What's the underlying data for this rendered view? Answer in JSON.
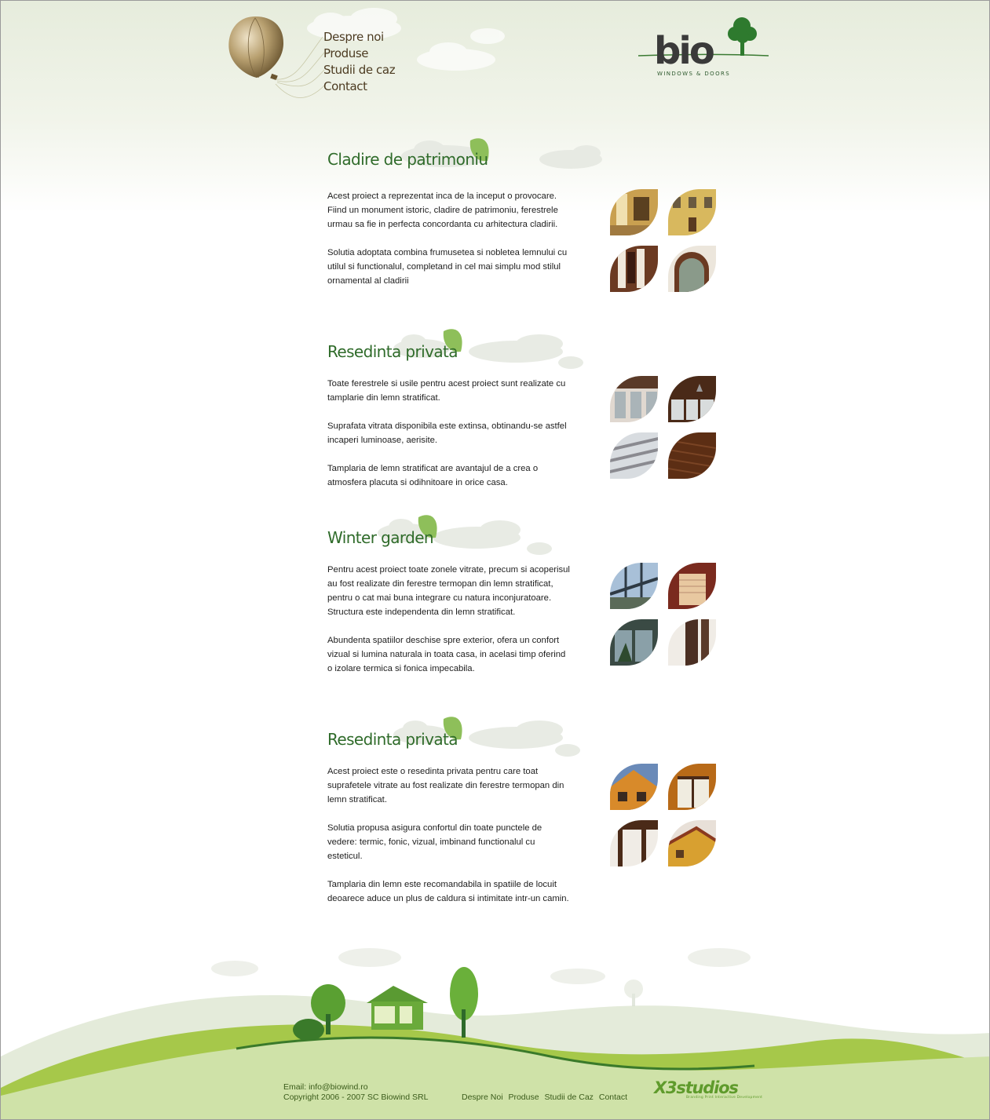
{
  "nav": {
    "items": [
      {
        "label": "Despre noi"
      },
      {
        "label": "Produse"
      },
      {
        "label": "Studii de caz"
      },
      {
        "label": "Contact"
      }
    ]
  },
  "logo": {
    "brand": "bio",
    "tagline": "WINDOWS & DOORS"
  },
  "sections": [
    {
      "title": "Cladire de patrimoniu",
      "paragraphs": [
        "Acest proiect a reprezentat inca de la inceput o provocare. Fiind un monument istoric, cladire de patrimoniu, ferestrele urmau sa fie in perfecta concordanta cu arhitectura cladirii.",
        "Solutia adoptata combina frumusetea si nobletea lemnului cu utilul si functionalul, completand in cel mai simplu mod stilul ornamental al cladirii"
      ],
      "thumbs": [
        "#c9a050",
        "#d8b85e",
        "#6b3a22",
        "#d8d0c4"
      ]
    },
    {
      "title": "Resedinta privata",
      "paragraphs": [
        "Toate ferestrele si usile pentru acest proiect sunt realizate cu tamplarie din lemn stratificat.",
        "Suprafata vitrata disponibila este extinsa, obtinandu-se astfel incaperi luminoase, aerisite.",
        "Tamplaria de lemn stratificat are avantajul de a crea o atmosfera placuta si odihnitoare in orice casa."
      ],
      "thumbs": [
        "#5a3a28",
        "#4a2a18",
        "#b8b8c0",
        "#5c2e14"
      ]
    },
    {
      "title": "Winter garden",
      "paragraphs": [
        "Pentru acest proiect toate zonele vitrate, precum si acoperisul au fost realizate din ferestre termopan din lemn stratificat, pentru o cat mai buna integrare cu natura inconjuratoare. Structura este independenta din lemn stratificat.",
        "Abundenta spatiilor deschise spre exterior, ofera un confort vizual si lumina naturala in toata casa, in acelasi timp oferind o izolare termica si fonica impecabila."
      ],
      "thumbs": [
        "#2e3a44",
        "#7a2a1e",
        "#3a4a44",
        "#4a2e22"
      ]
    },
    {
      "title": "Resedinta privata",
      "paragraphs": [
        "Acest proiect este o resedinta privata pentru care toat suprafetele vitrate au fost realizate din ferestre termopan din lemn stratificat.",
        "Solutia propusa asigura confortul din toate punctele de vedere: termic, fonic, vizual, imbinand functionalul cu esteticul.",
        "Tamplaria din lemn este recomandabila in spatiile de locuit deoarece aduce un plus de caldura si intimitate intr-un camin."
      ],
      "thumbs": [
        "#d88a2a",
        "#b86a18",
        "#4a2a18",
        "#d8a030"
      ]
    }
  ],
  "footer": {
    "email": "Email:  info@biowind.ro",
    "copyright": "Copyright 2006 - 2007 SC Biowind SRL",
    "nav": [
      "Despre Noi",
      "Produse",
      "Studii de Caz",
      "Contact"
    ],
    "credit": "X3studios",
    "credit_sub": "Branding Print Interactive Development"
  }
}
